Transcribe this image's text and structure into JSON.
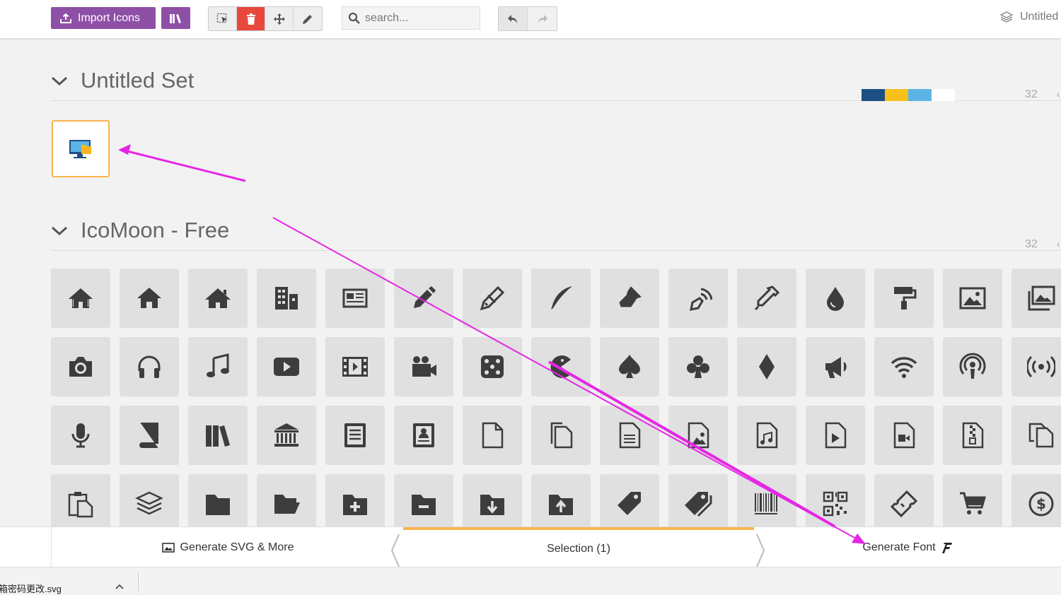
{
  "toolbar": {
    "import_label": "Import Icons",
    "search_placeholder": "search...",
    "project_name": "Untitled"
  },
  "sets": [
    {
      "title": "Untitled Set",
      "count": "32"
    },
    {
      "title": "IcoMoon - Free",
      "count": "32"
    }
  ],
  "palette": [
    "#1e4f82",
    "#f8c01a",
    "#5cb4e6",
    "#ffffff"
  ],
  "accent_colors": {
    "brand": "#8e4fa6",
    "danger": "#e8483c",
    "selection": "#f8b54c",
    "annotation": "#e626e6"
  },
  "selected_icons": [
    "computer-folder-icon"
  ],
  "icon_grid": [
    [
      "home-icon",
      "home2-icon",
      "home3-icon",
      "office-icon",
      "newspaper-icon",
      "pencil-icon",
      "pencil2-icon",
      "quill-icon",
      "pen-icon",
      "blog-icon",
      "eyedropper-icon",
      "droplet-icon",
      "paint-format-icon",
      "image-icon",
      "images-icon"
    ],
    [
      "camera-icon",
      "headphones-icon",
      "music-icon",
      "play-icon",
      "film-icon",
      "video-camera-icon",
      "dice-icon",
      "pacman-icon",
      "spades-icon",
      "clubs-icon",
      "diamonds-icon",
      "bullhorn-icon",
      "connection-icon",
      "podcast-icon",
      "feed-icon"
    ],
    [
      "mic-icon",
      "book-icon",
      "books-icon",
      "library-icon",
      "file-text-icon",
      "profile-icon",
      "file-empty-icon",
      "files-empty-icon",
      "file-text2-icon",
      "file-picture-icon",
      "file-music-icon",
      "file-play-icon",
      "file-video-icon",
      "file-zip-icon",
      "copy-icon"
    ],
    [
      "paste-icon",
      "stack-icon",
      "folder-icon",
      "folder-open-icon",
      "folder-plus-icon",
      "folder-minus-icon",
      "folder-download-icon",
      "folder-upload-icon",
      "price-tag-icon",
      "price-tags-icon",
      "barcode-icon",
      "qrcode-icon",
      "ticket-icon",
      "cart-icon",
      "coin-dollar-icon"
    ]
  ],
  "footer": {
    "generate_svg_label": "Generate SVG & More",
    "selection_label": "Selection (1)",
    "generate_font_label": "Generate Font"
  },
  "download_bar": {
    "item_label": "箱密码更改.svg"
  }
}
